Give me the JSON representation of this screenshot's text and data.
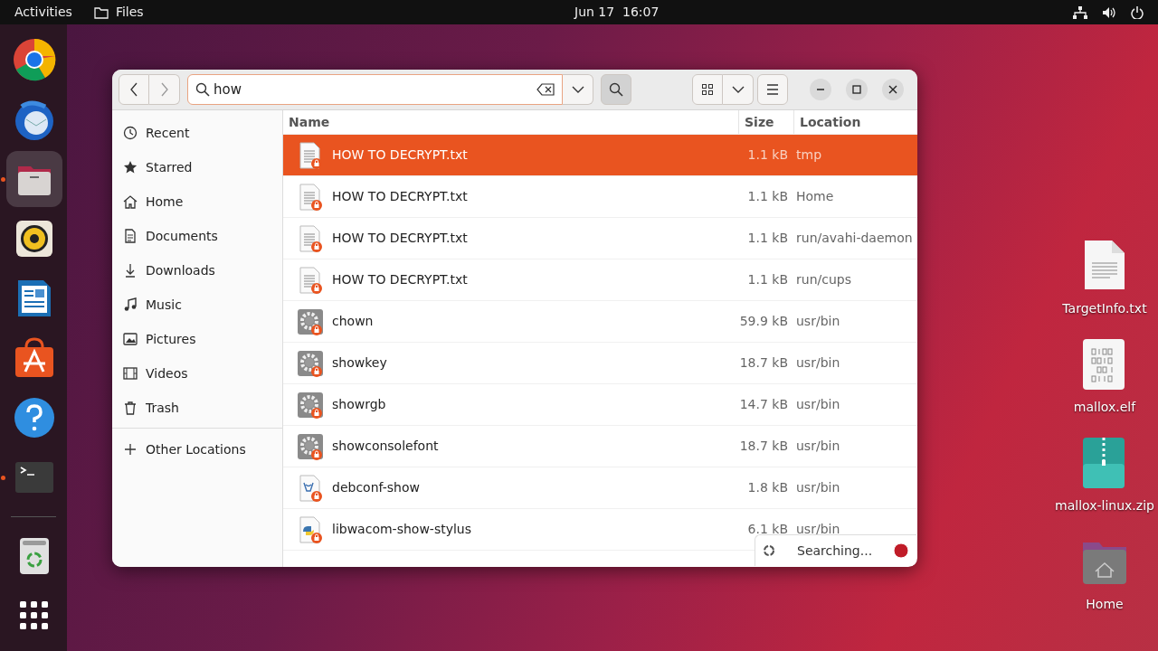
{
  "top_bar": {
    "activities": "Activities",
    "app_name": "Files",
    "clock": "Jun 17  16:07"
  },
  "dock": [
    {
      "kind": "browser",
      "running": false,
      "selected": false
    },
    {
      "kind": "mail",
      "running": false,
      "selected": false
    },
    {
      "kind": "files",
      "running": true,
      "selected": true
    },
    {
      "kind": "audio",
      "running": false,
      "selected": false
    },
    {
      "kind": "writer",
      "running": false,
      "selected": false
    },
    {
      "kind": "store",
      "running": false,
      "selected": false
    },
    {
      "kind": "help",
      "running": false,
      "selected": false
    },
    {
      "kind": "terminal",
      "running": true,
      "selected": false
    },
    {
      "kind": "trash",
      "running": false,
      "selected": false
    },
    {
      "kind": "apps",
      "running": false,
      "selected": false
    }
  ],
  "window": {
    "search": {
      "value": "how"
    },
    "sidebar": {
      "items": [
        {
          "kind": "recent",
          "label": "Recent"
        },
        {
          "kind": "starred",
          "label": "Starred"
        },
        {
          "kind": "home",
          "label": "Home"
        },
        {
          "kind": "documents",
          "label": "Documents"
        },
        {
          "kind": "downloads",
          "label": "Downloads"
        },
        {
          "kind": "music",
          "label": "Music"
        },
        {
          "kind": "pictures",
          "label": "Pictures"
        },
        {
          "kind": "videos",
          "label": "Videos"
        },
        {
          "kind": "trash",
          "label": "Trash"
        }
      ],
      "other": {
        "label": "Other Locations"
      }
    },
    "table": {
      "columns": [
        "Name",
        "Size",
        "Location"
      ],
      "rows": [
        {
          "kind": "text",
          "locked": true,
          "name": "HOW TO DECRYPT.txt",
          "size": "1.1 kB",
          "location": "tmp",
          "selected": true
        },
        {
          "kind": "text",
          "locked": true,
          "name": "HOW TO DECRYPT.txt",
          "size": "1.1 kB",
          "location": "Home",
          "selected": false
        },
        {
          "kind": "text",
          "locked": true,
          "name": "HOW TO DECRYPT.txt",
          "size": "1.1 kB",
          "location": "run/avahi-daemon",
          "selected": false
        },
        {
          "kind": "text",
          "locked": true,
          "name": "HOW TO DECRYPT.txt",
          "size": "1.1 kB",
          "location": "run/cups",
          "selected": false
        },
        {
          "kind": "exec",
          "locked": true,
          "name": "chown",
          "size": "59.9 kB",
          "location": "usr/bin",
          "selected": false
        },
        {
          "kind": "exec",
          "locked": true,
          "name": "showkey",
          "size": "18.7 kB",
          "location": "usr/bin",
          "selected": false
        },
        {
          "kind": "exec",
          "locked": true,
          "name": "showrgb",
          "size": "14.7 kB",
          "location": "usr/bin",
          "selected": false
        },
        {
          "kind": "exec",
          "locked": true,
          "name": "showconsolefont",
          "size": "18.7 kB",
          "location": "usr/bin",
          "selected": false
        },
        {
          "kind": "debconf",
          "locked": true,
          "name": "debconf-show",
          "size": "1.8 kB",
          "location": "usr/bin",
          "selected": false
        },
        {
          "kind": "python",
          "locked": true,
          "name": "libwacom-show-stylus",
          "size": "6.1 kB",
          "location": "usr/bin",
          "selected": false
        }
      ]
    },
    "status": {
      "text": "Searching..."
    }
  },
  "desktop_icons": [
    {
      "kind": "text",
      "label": "TargetInfo.txt"
    },
    {
      "kind": "binary",
      "label": "mallox.elf"
    },
    {
      "kind": "zip",
      "label": "mallox-linux.zip"
    },
    {
      "kind": "folder",
      "label": "Home"
    }
  ]
}
